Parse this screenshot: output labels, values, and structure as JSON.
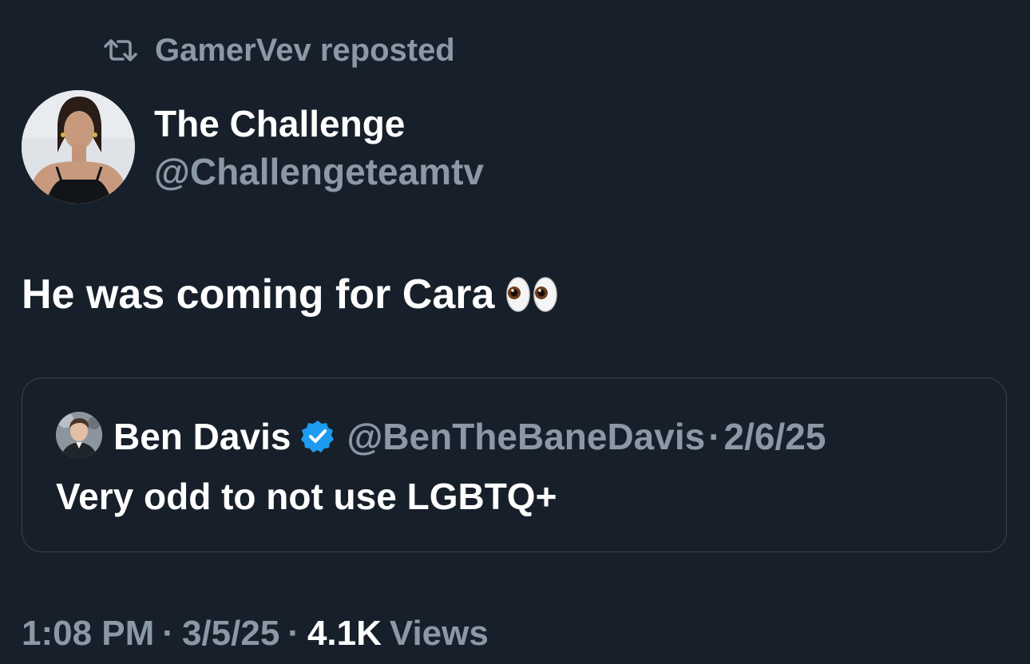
{
  "repost": {
    "label": "GamerVev reposted",
    "icon": "repost-icon"
  },
  "author": {
    "name": "The Challenge",
    "handle": "@Challengeteamtv",
    "avatar": "avatar"
  },
  "post": {
    "text": "He was coming for Cara",
    "emoji": "eyes-emoji"
  },
  "quote": {
    "name": "Ben Davis",
    "verified_icon": "verified-badge-icon",
    "handle": "@BenTheBaneDavis",
    "separator": "·",
    "date": "2/6/25",
    "text": "Very odd to not use LGBTQ+"
  },
  "meta": {
    "time": "1:08 PM",
    "sep1": "·",
    "date": "3/5/25",
    "sep2": "·",
    "views_count": "4.1K",
    "views_label": "Views"
  },
  "colors": {
    "background": "#17202a",
    "primary_text": "#ffffff",
    "secondary_text": "#8b98a5",
    "border": "#38444d",
    "verified_blue": "#1d9bf0"
  }
}
